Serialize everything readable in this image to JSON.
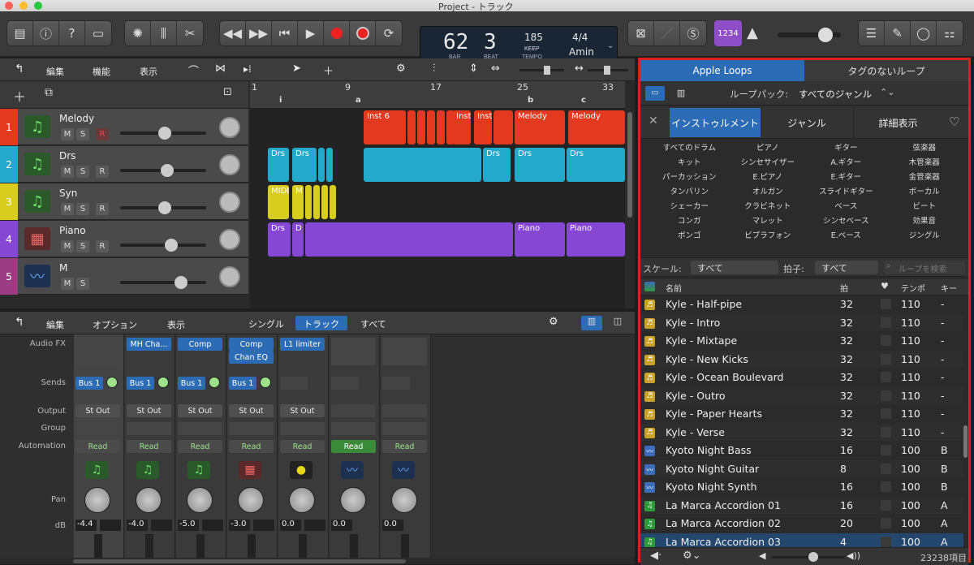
{
  "window": {
    "title": "Project - トラック"
  },
  "toolbar": {
    "icons": [
      "inbox-icon",
      "info-icon",
      "help-icon",
      "inspector-icon",
      "smart-controls-icon",
      "mixer-icon",
      "scissors-icon"
    ],
    "transport": [
      "rewind-icon",
      "forward-icon",
      "to-start-icon",
      "play-icon",
      "record-icon",
      "capture-record-icon",
      "cycle-icon"
    ],
    "right_icons": [
      "tuner-icon",
      "pencil-icon",
      "s-icon",
      "count-in-icon",
      "metronome-icon",
      "list-icon",
      "notepad-icon",
      "loop-browser-icon",
      "browser-icon"
    ],
    "count_in": "1234"
  },
  "lcd": {
    "bar": "62",
    "beat": "3",
    "bar_label": "BAR",
    "beat_label": "BEAT",
    "tempo": "185",
    "keep": "KEEP",
    "tempo_label": "TEMPO",
    "sig": "4/4",
    "key": "Amin"
  },
  "tracks": {
    "menus": {
      "edit": "編集",
      "function": "機能",
      "view": "表示"
    },
    "ruler": [
      "1",
      "9",
      "17",
      "25",
      "33"
    ],
    "markers": [
      "i",
      "a",
      "b",
      "c"
    ],
    "list": [
      {
        "num": "1",
        "name": "Melody",
        "color": "#e3391e",
        "icon": "midi-icon",
        "vol": 0.55
      },
      {
        "num": "2",
        "name": "Drs",
        "color": "#23a9c9",
        "icon": "midi-icon",
        "vol": 0.58
      },
      {
        "num": "3",
        "name": "Syn",
        "color": "#d8cd1e",
        "icon": "midi-icon",
        "vol": 0.55
      },
      {
        "num": "4",
        "name": "Piano",
        "color": "#8648d4",
        "icon": "accordion-icon",
        "vol": 0.63
      },
      {
        "num": "5",
        "name": "M",
        "color": "#9c3d84",
        "icon": "waveform-icon",
        "vol": 0.75
      }
    ],
    "mute": "M",
    "solo": "S",
    "rec": "R",
    "regions": {
      "melody": [
        "Inst 6",
        "Inst",
        "Inst",
        "Melody",
        "Melody"
      ],
      "drums": [
        "Drs",
        "Drs",
        "Drs",
        "Drs",
        "Drs"
      ],
      "syn": [
        "MIDI",
        "M"
      ],
      "piano": [
        "Drs",
        "D",
        "Piano",
        "Piano"
      ]
    }
  },
  "mixer": {
    "menus": {
      "edit": "編集",
      "options": "オプション",
      "view": "表示"
    },
    "tabs": [
      "シングル",
      "トラック",
      "すべて"
    ],
    "row_labels": {
      "audiofx": "Audio FX",
      "sends": "Sends",
      "output": "Output",
      "group": "Group",
      "automation": "Automation",
      "pan": "Pan",
      "db": "dB"
    },
    "channels": [
      {
        "fx": "",
        "fx2": "",
        "send": "Bus 1",
        "out": "St Out",
        "auto": "Read",
        "db": "-4.4",
        "icon": "midi-icon"
      },
      {
        "fx": "MH Cha...",
        "fx2": "",
        "send": "Bus 1",
        "out": "St Out",
        "auto": "Read",
        "db": "-4.0",
        "icon": "midi-icon"
      },
      {
        "fx": "Comp",
        "fx2": "",
        "send": "Bus 1",
        "out": "St Out",
        "auto": "Read",
        "db": "-5.0",
        "icon": "midi-icon"
      },
      {
        "fx": "Comp",
        "fx2": "Chan EQ",
        "send": "Bus 1",
        "out": "St Out",
        "auto": "Read",
        "db": "-3.0",
        "icon": "accordion-icon"
      },
      {
        "fx": "L1 limiter",
        "fx2": "",
        "send": "",
        "out": "St Out",
        "auto": "Read",
        "db": "0.0",
        "icon": "metronome-knob-icon"
      },
      {
        "fx": "",
        "fx2": "",
        "send": "",
        "out": "",
        "auto": "Read",
        "db": "0.0",
        "icon": "waveform-icon"
      },
      {
        "fx": "",
        "fx2": "",
        "send": "",
        "out": "",
        "auto": "Read",
        "db": "0.0",
        "icon": "waveform-icon"
      }
    ]
  },
  "loops": {
    "tabs": [
      "Apple Loops",
      "タグのないループ"
    ],
    "pack_label": "ループパック:",
    "pack_value": "すべてのジャンル",
    "filter_tabs": [
      "インストゥルメント",
      "ジャンル",
      "詳細表示"
    ],
    "categories": [
      [
        "すべてのドラム",
        "ピアノ",
        "ギター",
        "弦楽器"
      ],
      [
        "キット",
        "シンセサイザー",
        "A.ギター",
        "木管楽器"
      ],
      [
        "パーカッション",
        "E.ピアノ",
        "E.ギター",
        "金管楽器"
      ],
      [
        "タンバリン",
        "オルガン",
        "スライドギター",
        "ボーカル"
      ],
      [
        "シェーカー",
        "クラビネット",
        "ベース",
        "ビート"
      ],
      [
        "コンガ",
        "マレット",
        "シンセベース",
        "効果音"
      ],
      [
        "ボンゴ",
        "ビブラフォン",
        "E.ベース",
        "ジングル"
      ]
    ],
    "scale_label": "スケール:",
    "scale_value": "すべて",
    "sig_label": "拍子:",
    "sig_value": "すべて",
    "search_placeholder": "ループを検索",
    "headers": {
      "name": "名前",
      "beats": "拍",
      "tempo": "テンポ",
      "key": "キー"
    },
    "rows": [
      {
        "type": "drummer",
        "name": "Kyle - Half-pipe",
        "beats": "32",
        "tempo": "110",
        "key": "-"
      },
      {
        "type": "drummer",
        "name": "Kyle - Intro",
        "beats": "32",
        "tempo": "110",
        "key": "-"
      },
      {
        "type": "drummer",
        "name": "Kyle - Mixtape",
        "beats": "32",
        "tempo": "110",
        "key": "-"
      },
      {
        "type": "drummer",
        "name": "Kyle - New Kicks",
        "beats": "32",
        "tempo": "110",
        "key": "-"
      },
      {
        "type": "drummer",
        "name": "Kyle - Ocean Boulevard",
        "beats": "32",
        "tempo": "110",
        "key": "-"
      },
      {
        "type": "drummer",
        "name": "Kyle - Outro",
        "beats": "32",
        "tempo": "110",
        "key": "-"
      },
      {
        "type": "drummer",
        "name": "Kyle - Paper Hearts",
        "beats": "32",
        "tempo": "110",
        "key": "-"
      },
      {
        "type": "drummer",
        "name": "Kyle - Verse",
        "beats": "32",
        "tempo": "110",
        "key": "-"
      },
      {
        "type": "audio",
        "name": "Kyoto Night Bass",
        "beats": "16",
        "tempo": "100",
        "key": "B"
      },
      {
        "type": "audio",
        "name": "Kyoto Night Guitar",
        "beats": "8",
        "tempo": "100",
        "key": "B"
      },
      {
        "type": "audio",
        "name": "Kyoto Night Synth",
        "beats": "16",
        "tempo": "100",
        "key": "B"
      },
      {
        "type": "midi",
        "name": "La Marca Accordion 01",
        "beats": "16",
        "tempo": "100",
        "key": "A"
      },
      {
        "type": "midi",
        "name": "La Marca Accordion 02",
        "beats": "20",
        "tempo": "100",
        "key": "A"
      },
      {
        "type": "midi",
        "name": "La Marca Accordion 03",
        "beats": "4",
        "tempo": "100",
        "key": "A"
      }
    ],
    "count": "23238項目"
  },
  "colors": {
    "accent": "#2c6cb4",
    "highlight": "#e0201b",
    "drummer": "#c9a227",
    "audio": "#3c6dbb",
    "midi": "#2f9a3a"
  }
}
